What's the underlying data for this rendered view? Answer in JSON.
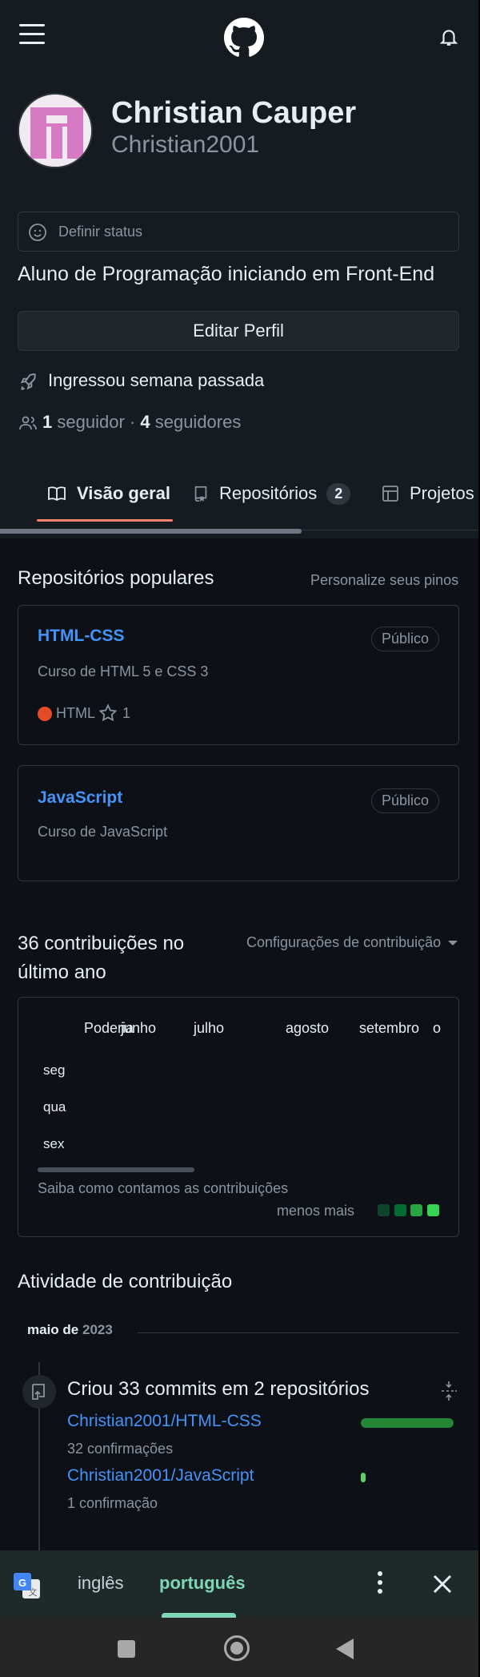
{
  "header": {
    "menu_icon": "hamburger-icon",
    "logo_icon": "github-logo-icon",
    "notifications_icon": "bell-icon"
  },
  "profile": {
    "name": "Christian Cauper",
    "login": "Christian2001",
    "status_placeholder": "Definir status",
    "bio": "Aluno de Programação iniciando em Front-End",
    "edit_button": "Editar Perfil",
    "joined": "Ingressou semana passada",
    "following_count": "1",
    "following_label": "seguidor",
    "separator": "·",
    "followers_count": "4",
    "followers_label": "seguidores"
  },
  "tabs": [
    {
      "label": "Visão geral",
      "icon": "book-icon",
      "active": true
    },
    {
      "label": "Repositórios",
      "icon": "repo-icon",
      "count": "2"
    },
    {
      "label": "Projetos",
      "icon": "table-icon"
    }
  ],
  "popular": {
    "title": "Repositórios populares",
    "customize_link": "Personalize seus pinos",
    "repos": [
      {
        "name": "HTML-CSS",
        "visibility": "Público",
        "description": "Curso de HTML 5 e CSS 3",
        "language": "HTML",
        "language_color": "#e34c26",
        "stars": "1"
      },
      {
        "name": "JavaScript",
        "visibility": "Público",
        "description": "Curso de JavaScript"
      }
    ]
  },
  "contributions": {
    "title": "36 contribuições no último ano",
    "settings": "Configurações de contribuição",
    "months": [
      "Poderia",
      "junho",
      "julho",
      "agosto",
      "setembro",
      "o"
    ],
    "days": [
      "seg",
      "qua",
      "sex"
    ],
    "learn_link": "Saiba como contamos as contribuições",
    "legend": "menos mais",
    "legend_colors": [
      "#0e4429",
      "#006d32",
      "#26a641",
      "#39d353"
    ]
  },
  "activity": {
    "title": "Atividade de contribuição",
    "month_label": "maio de",
    "month_year": "2023",
    "commits_title": "Criou 33 commits em 2 repositórios",
    "repos": [
      {
        "name": "Christian2001/HTML-CSS",
        "count": "32 confirmações",
        "share": 0.97
      },
      {
        "name": "Christian2001/JavaScript",
        "count": "1 confirmação",
        "share": 0.03
      }
    ]
  },
  "translate_bar": {
    "icon": "google-translate-icon",
    "source": "inglês",
    "target": "português",
    "menu_icon": "more-vertical-icon",
    "close_icon": "close-icon"
  },
  "navbar": {
    "recents_icon": "square-icon",
    "home_icon": "home-circle-icon",
    "back_icon": "back-triangle-icon"
  }
}
